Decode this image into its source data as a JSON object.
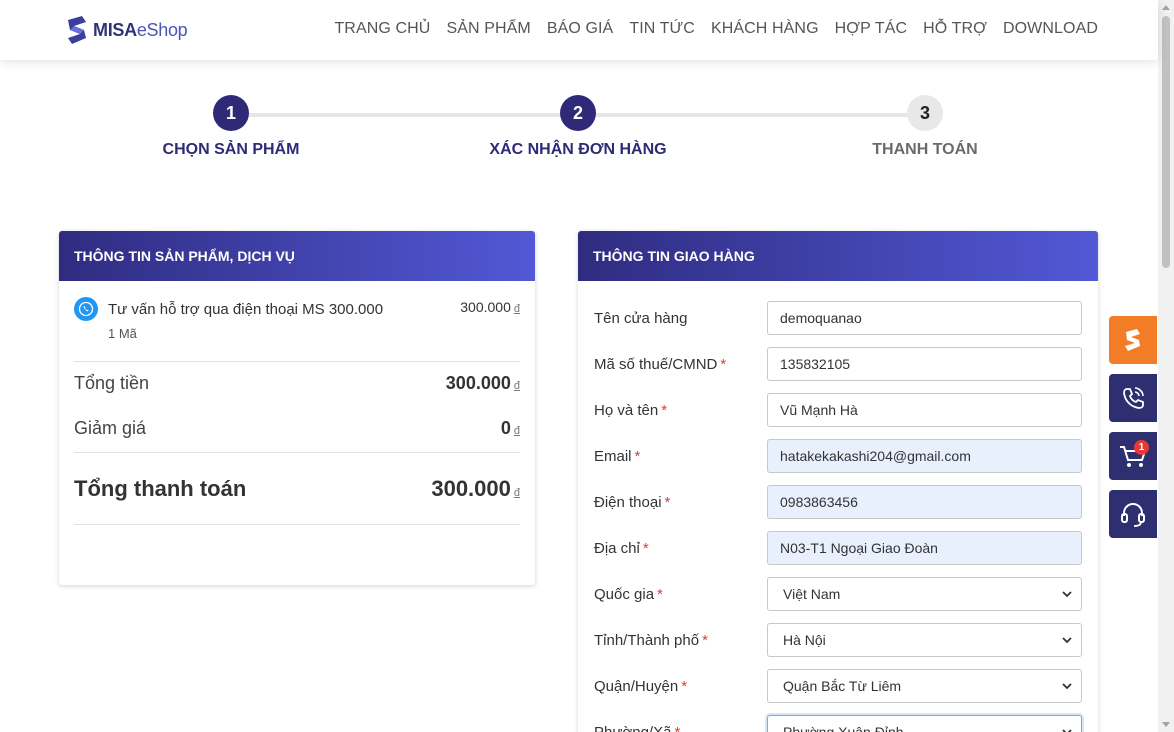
{
  "header": {
    "logo_brand": "MISA",
    "logo_product": "eShop",
    "nav": [
      "TRANG CHỦ",
      "SẢN PHẨM",
      "BÁO GIÁ",
      "TIN TỨC",
      "KHÁCH HÀNG",
      "HỢP TÁC",
      "HỖ TRỢ",
      "DOWNLOAD"
    ]
  },
  "stepper": {
    "steps": [
      {
        "number": "1",
        "label": "CHỌN SẢN PHẨM",
        "state": "active"
      },
      {
        "number": "2",
        "label": "XÁC NHẬN ĐƠN HÀNG",
        "state": "active"
      },
      {
        "number": "3",
        "label": "THANH TOÁN",
        "state": "inactive"
      }
    ]
  },
  "product_card": {
    "title": "THÔNG TIN SẢN PHẨM, DỊCH VỤ",
    "item": {
      "name": "Tư vấn hỗ trợ qua điện thoại MS 300.000",
      "quantity": "1 Mã",
      "price": "300.000",
      "icon": "phone-support-icon"
    },
    "currency": "đ",
    "subtotal_label": "Tổng tiền",
    "subtotal_value": "300.000",
    "discount_label": "Giảm giá",
    "discount_value": "0",
    "total_label": "Tổng thanh toán",
    "total_value": "300.000"
  },
  "shipping_card": {
    "title": "THÔNG TIN GIAO HÀNG",
    "fields": [
      {
        "label": "Tên cửa hàng",
        "required": false,
        "value": "demoquanao",
        "type": "text",
        "autofilled": false
      },
      {
        "label": "Mã số thuế/CMND",
        "required": true,
        "value": "135832105",
        "type": "text",
        "autofilled": false
      },
      {
        "label": "Họ và tên",
        "required": true,
        "value": "Vũ Mạnh Hà",
        "type": "text",
        "autofilled": false
      },
      {
        "label": "Email",
        "required": true,
        "value": "hatakekakashi204@gmail.com",
        "type": "text",
        "autofilled": true
      },
      {
        "label": "Điện thoại",
        "required": true,
        "value": "0983863456",
        "type": "text",
        "autofilled": true
      },
      {
        "label": "Địa chỉ",
        "required": true,
        "value": "N03-T1 Ngoại Giao Đoàn",
        "type": "text",
        "autofilled": true
      },
      {
        "label": "Quốc gia",
        "required": true,
        "value": "Việt Nam",
        "type": "select",
        "autofilled": false
      },
      {
        "label": "Tỉnh/Thành phố",
        "required": true,
        "value": "Hà Nội",
        "type": "select",
        "autofilled": false
      },
      {
        "label": "Quận/Huyện",
        "required": true,
        "value": "Quận Bắc Từ Liêm",
        "type": "select",
        "autofilled": false
      },
      {
        "label": "Phường/Xã",
        "required": true,
        "value": "Phường Xuân Đỉnh",
        "type": "select",
        "autofilled": false,
        "focused": true
      }
    ],
    "required_mark": "*"
  },
  "side_buttons": [
    {
      "name": "misa-logo-icon",
      "color": "#f27d26"
    },
    {
      "name": "phone-call-icon",
      "color": "#2e2f70"
    },
    {
      "name": "cart-icon",
      "color": "#2e2f70",
      "badge": "1"
    },
    {
      "name": "headset-icon",
      "color": "#2e2f70"
    }
  ],
  "colors": {
    "brand_navy": "#2e2a78",
    "gradient_end": "#5258d6",
    "accent_orange": "#f27d26",
    "required_red": "#e53935",
    "autofill_bg": "#e8f0fe"
  }
}
